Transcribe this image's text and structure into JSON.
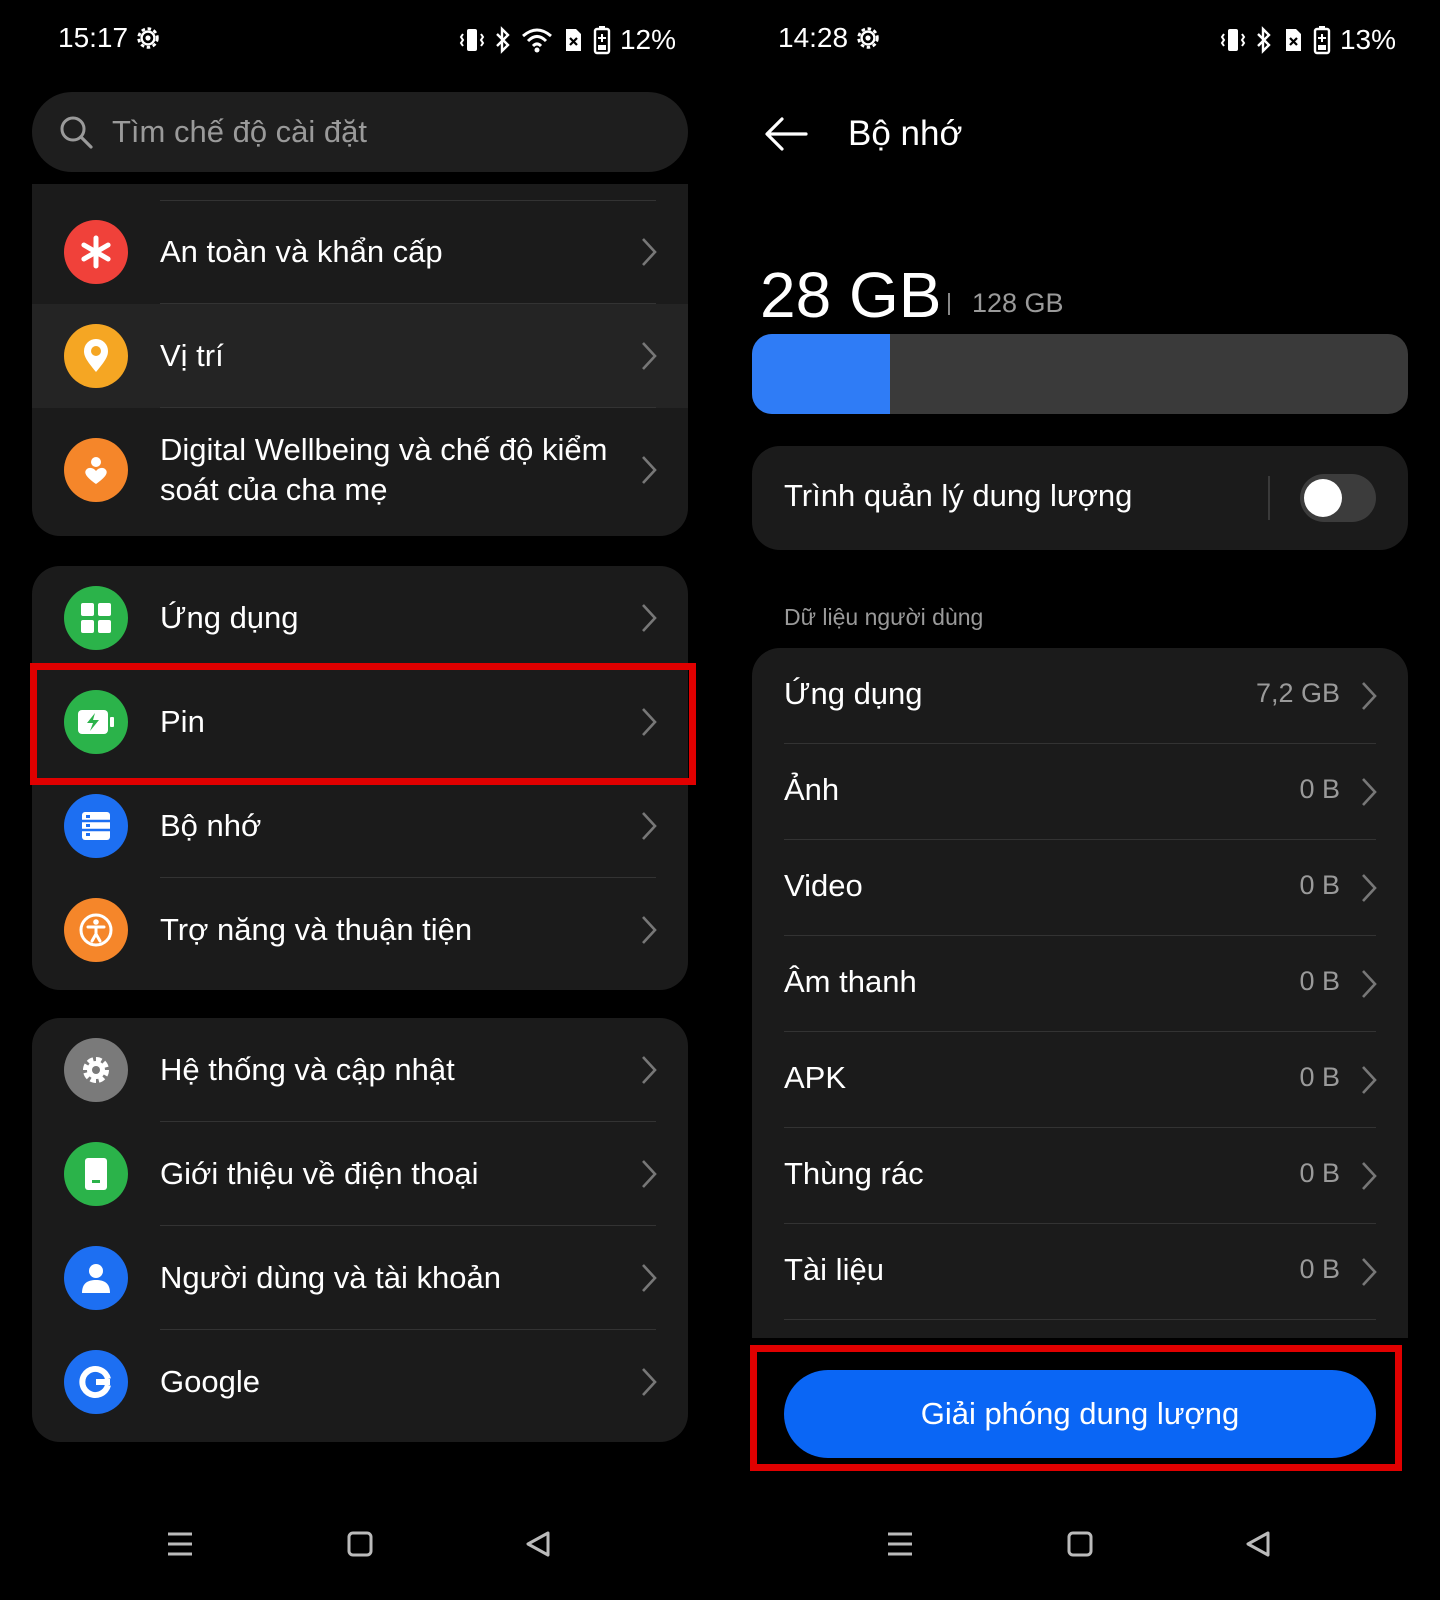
{
  "left": {
    "status": {
      "time": "15:17",
      "battery": "12%"
    },
    "search": {
      "placeholder": "Tìm chế độ cài đặt"
    },
    "groups": [
      {
        "items": [
          {
            "label": "An toàn và khẩn cấp",
            "icon": "emergency-asterisk-icon",
            "color": "#f0413a"
          },
          {
            "label": "Vị trí",
            "icon": "location-pin-icon",
            "color": "#f5a623"
          },
          {
            "label": "Digital Wellbeing và chế độ kiểm soát của cha mẹ",
            "icon": "wellbeing-heart-icon",
            "color": "#f5862a"
          }
        ]
      },
      {
        "items": [
          {
            "label": "Ứng dụng",
            "icon": "apps-grid-icon",
            "color": "#2bb34a"
          },
          {
            "label": "Pin",
            "icon": "battery-charging-icon",
            "color": "#2bb34a"
          },
          {
            "label": "Bộ nhớ",
            "icon": "storage-icon",
            "color": "#1d6ff2"
          },
          {
            "label": "Trợ năng và thuận tiện",
            "icon": "accessibility-icon",
            "color": "#f5862a"
          }
        ]
      },
      {
        "items": [
          {
            "label": "Hệ thống và cập nhật",
            "icon": "system-gear-icon",
            "color": "#7a7a7a"
          },
          {
            "label": "Giới thiệu về điện thoại",
            "icon": "phone-info-icon",
            "color": "#2bb34a"
          },
          {
            "label": "Người dùng và tài khoản",
            "icon": "user-account-icon",
            "color": "#1d6ff2"
          },
          {
            "label": "Google",
            "icon": "google-icon",
            "color": "#1d6ff2"
          }
        ]
      }
    ]
  },
  "right": {
    "status": {
      "time": "14:28",
      "battery": "13%"
    },
    "title": "Bộ nhớ",
    "storage": {
      "used": "28 GB",
      "total": "128 GB",
      "used_fraction": 0.21
    },
    "manager": {
      "label": "Trình quản lý dung lượng",
      "enabled": false
    },
    "section_label": "Dữ liệu người dùng",
    "items": [
      {
        "label": "Ứng dụng",
        "value": "7,2 GB"
      },
      {
        "label": "Ảnh",
        "value": "0 B"
      },
      {
        "label": "Video",
        "value": "0 B"
      },
      {
        "label": "Âm thanh",
        "value": "0 B"
      },
      {
        "label": "APK",
        "value": "0 B"
      },
      {
        "label": "Thùng rác",
        "value": "0 B"
      },
      {
        "label": "Tài liệu",
        "value": "0 B"
      }
    ],
    "free_button": "Giải phóng dung lượng"
  },
  "colors": {
    "accent": "#0a66f5",
    "highlight": "#e00000",
    "card": "#1b1b1b"
  }
}
